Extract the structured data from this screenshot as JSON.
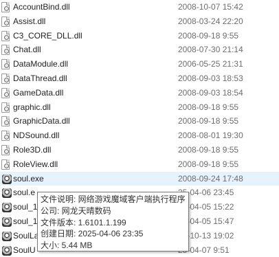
{
  "files": [
    {
      "name": "AccountBind.dll",
      "date": "2008-10-07 15:42",
      "type": "dll"
    },
    {
      "name": "Assist.dll",
      "date": "2008-03-24 22:20",
      "type": "dll"
    },
    {
      "name": "C3_CORE_DLL.dll",
      "date": "2008-09-18 9:55",
      "type": "dll"
    },
    {
      "name": "Chat.dll",
      "date": "2008-07-30 21:14",
      "type": "dll"
    },
    {
      "name": "DataModule.dll",
      "date": "2006-05-25 21:31",
      "type": "dll"
    },
    {
      "name": "DataThread.dll",
      "date": "2008-09-03 18:53",
      "type": "dll"
    },
    {
      "name": "GameData.dll",
      "date": "2008-09-03 18:54",
      "type": "dll"
    },
    {
      "name": "graphic.dll",
      "date": "2008-09-18 9:55",
      "type": "dll"
    },
    {
      "name": "GraphicData.dll",
      "date": "2008-09-18 9:55",
      "type": "dll"
    },
    {
      "name": "NDSound.dll",
      "date": "2008-08-01 19:30",
      "type": "dll"
    },
    {
      "name": "Role3D.dll",
      "date": "2008-09-18 9:55",
      "type": "dll"
    },
    {
      "name": "RoleView.dll",
      "date": "2008-09-18 9:55",
      "type": "dll"
    },
    {
      "name": "soul.exe",
      "date": "2008-09-24 17:48",
      "type": "exe"
    },
    {
      "name": "soul.e",
      "date": "25-04-06 23:45",
      "type": "exe"
    },
    {
      "name": "soul_1",
      "date": "25-04-05 15:22",
      "type": "exe"
    },
    {
      "name": "soul_1",
      "date": "25-04-05 15:47",
      "type": "exe"
    },
    {
      "name": "SoulLa",
      "date": "26-10-13 19:02",
      "type": "exe"
    },
    {
      "name": "SoulU",
      "date": "25-04-07 9:51",
      "type": "exe"
    }
  ],
  "tooltip": {
    "description": "文件说明: 网络游戏魔域客户端执行程序",
    "company": "公司: 网龙天晴数码",
    "version": "文件版本: 1.6101.1.199",
    "created": "创建日期: 2025-04-06 23:35",
    "size": "大小: 5.44 MB"
  },
  "icons": {
    "dll": "dll-file-icon",
    "exe": "exe-app-icon"
  },
  "colors": {
    "hover_row": "#e5f3ff",
    "date_text": "#6d6d6d"
  }
}
